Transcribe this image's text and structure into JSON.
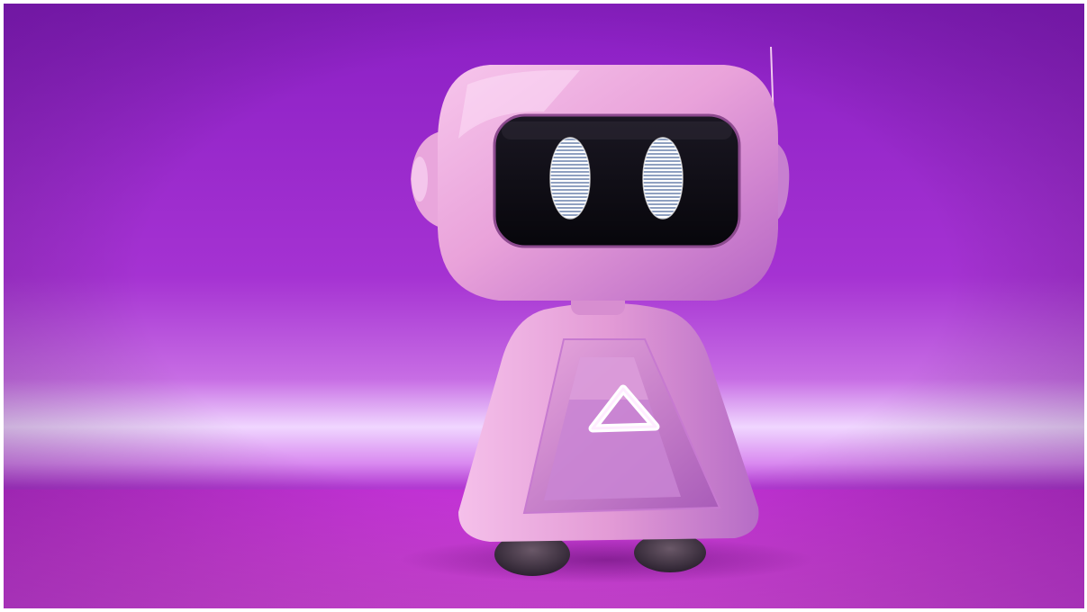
{
  "image": {
    "subject": "robot-figurine",
    "colors": {
      "background_top": "#8a1fc4",
      "background_mid": "#b43fd8",
      "glow": "#f3d8ff",
      "floor": "#d63adf",
      "robot_body": "#e9a6dc",
      "visor": "#0d0b12",
      "eyes": "#ffffff",
      "emblem": "#ffffff",
      "wheels": "#4a3a48"
    }
  }
}
